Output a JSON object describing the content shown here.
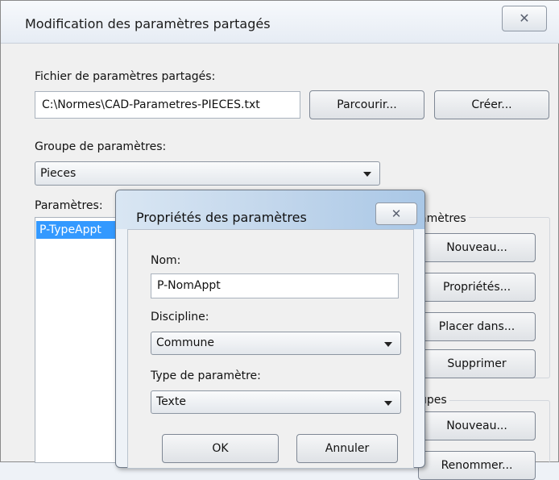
{
  "main": {
    "title": "Modification des paramètres partagés",
    "close_glyph": "✕",
    "file_label": "Fichier de paramètres partagés:",
    "file_value": "C:\\Normes\\CAD-Parametres-PIECES.txt",
    "browse_label": "Parcourir...",
    "create_label": "Créer...",
    "group_label": "Groupe de paramètres:",
    "group_value": "Pieces",
    "params_label": "Paramètres:",
    "params_items": [
      "P-TypeAppt"
    ],
    "params_box_title": "amètres",
    "new_param_label": "Nouveau...",
    "properties_label": "Propriétés...",
    "move_to_label": "Placer dans...",
    "delete_label": "Supprimer",
    "groups_box_title": "upes",
    "new_group_label": "Nouveau...",
    "rename_label": "Renommer..."
  },
  "dialog": {
    "title": "Propriétés des paramètres",
    "close_glyph": "✕",
    "name_label": "Nom:",
    "name_value": "P-NomAppt",
    "discipline_label": "Discipline:",
    "discipline_value": "Commune",
    "type_label": "Type de paramètre:",
    "type_value": "Texte",
    "ok_label": "OK",
    "cancel_label": "Annuler"
  }
}
